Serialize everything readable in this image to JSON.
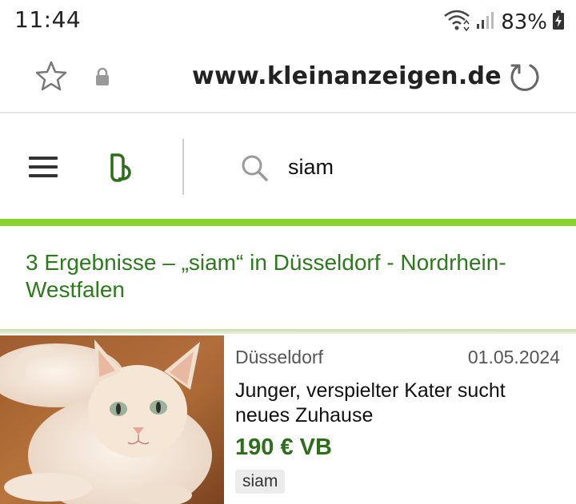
{
  "status_bar": {
    "time": "11:44",
    "battery_percent": "83%"
  },
  "browser": {
    "url": "www.kleinanzeigen.de"
  },
  "header": {
    "search_value": "siam"
  },
  "results": {
    "heading": "3 Ergebnisse – „siam“ in Düsseldorf - Nordrhein-Westfalen"
  },
  "listings": [
    {
      "location": "Düsseldorf",
      "date": "01.05.2024",
      "title": "Junger, verspielter Kater sucht neues Zuhause",
      "price": "190 € VB",
      "tag": "siam"
    }
  ],
  "colors": {
    "accent_green": "#86d22e",
    "text_green": "#2d7a1e",
    "price_green": "#2d6e1a"
  }
}
